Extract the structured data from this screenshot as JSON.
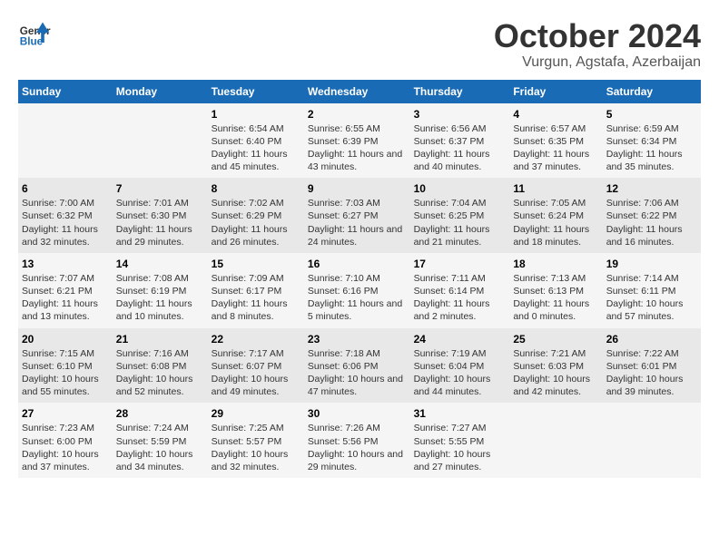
{
  "header": {
    "logo_general": "General",
    "logo_blue": "Blue",
    "month_title": "October 2024",
    "location": "Vurgun, Agstafa, Azerbaijan"
  },
  "days_of_week": [
    "Sunday",
    "Monday",
    "Tuesday",
    "Wednesday",
    "Thursday",
    "Friday",
    "Saturday"
  ],
  "weeks": [
    [
      {
        "day": "",
        "sunrise": "",
        "sunset": "",
        "daylight": ""
      },
      {
        "day": "",
        "sunrise": "",
        "sunset": "",
        "daylight": ""
      },
      {
        "day": "1",
        "sunrise": "Sunrise: 6:54 AM",
        "sunset": "Sunset: 6:40 PM",
        "daylight": "Daylight: 11 hours and 45 minutes."
      },
      {
        "day": "2",
        "sunrise": "Sunrise: 6:55 AM",
        "sunset": "Sunset: 6:39 PM",
        "daylight": "Daylight: 11 hours and 43 minutes."
      },
      {
        "day": "3",
        "sunrise": "Sunrise: 6:56 AM",
        "sunset": "Sunset: 6:37 PM",
        "daylight": "Daylight: 11 hours and 40 minutes."
      },
      {
        "day": "4",
        "sunrise": "Sunrise: 6:57 AM",
        "sunset": "Sunset: 6:35 PM",
        "daylight": "Daylight: 11 hours and 37 minutes."
      },
      {
        "day": "5",
        "sunrise": "Sunrise: 6:59 AM",
        "sunset": "Sunset: 6:34 PM",
        "daylight": "Daylight: 11 hours and 35 minutes."
      }
    ],
    [
      {
        "day": "6",
        "sunrise": "Sunrise: 7:00 AM",
        "sunset": "Sunset: 6:32 PM",
        "daylight": "Daylight: 11 hours and 32 minutes."
      },
      {
        "day": "7",
        "sunrise": "Sunrise: 7:01 AM",
        "sunset": "Sunset: 6:30 PM",
        "daylight": "Daylight: 11 hours and 29 minutes."
      },
      {
        "day": "8",
        "sunrise": "Sunrise: 7:02 AM",
        "sunset": "Sunset: 6:29 PM",
        "daylight": "Daylight: 11 hours and 26 minutes."
      },
      {
        "day": "9",
        "sunrise": "Sunrise: 7:03 AM",
        "sunset": "Sunset: 6:27 PM",
        "daylight": "Daylight: 11 hours and 24 minutes."
      },
      {
        "day": "10",
        "sunrise": "Sunrise: 7:04 AM",
        "sunset": "Sunset: 6:25 PM",
        "daylight": "Daylight: 11 hours and 21 minutes."
      },
      {
        "day": "11",
        "sunrise": "Sunrise: 7:05 AM",
        "sunset": "Sunset: 6:24 PM",
        "daylight": "Daylight: 11 hours and 18 minutes."
      },
      {
        "day": "12",
        "sunrise": "Sunrise: 7:06 AM",
        "sunset": "Sunset: 6:22 PM",
        "daylight": "Daylight: 11 hours and 16 minutes."
      }
    ],
    [
      {
        "day": "13",
        "sunrise": "Sunrise: 7:07 AM",
        "sunset": "Sunset: 6:21 PM",
        "daylight": "Daylight: 11 hours and 13 minutes."
      },
      {
        "day": "14",
        "sunrise": "Sunrise: 7:08 AM",
        "sunset": "Sunset: 6:19 PM",
        "daylight": "Daylight: 11 hours and 10 minutes."
      },
      {
        "day": "15",
        "sunrise": "Sunrise: 7:09 AM",
        "sunset": "Sunset: 6:17 PM",
        "daylight": "Daylight: 11 hours and 8 minutes."
      },
      {
        "day": "16",
        "sunrise": "Sunrise: 7:10 AM",
        "sunset": "Sunset: 6:16 PM",
        "daylight": "Daylight: 11 hours and 5 minutes."
      },
      {
        "day": "17",
        "sunrise": "Sunrise: 7:11 AM",
        "sunset": "Sunset: 6:14 PM",
        "daylight": "Daylight: 11 hours and 2 minutes."
      },
      {
        "day": "18",
        "sunrise": "Sunrise: 7:13 AM",
        "sunset": "Sunset: 6:13 PM",
        "daylight": "Daylight: 11 hours and 0 minutes."
      },
      {
        "day": "19",
        "sunrise": "Sunrise: 7:14 AM",
        "sunset": "Sunset: 6:11 PM",
        "daylight": "Daylight: 10 hours and 57 minutes."
      }
    ],
    [
      {
        "day": "20",
        "sunrise": "Sunrise: 7:15 AM",
        "sunset": "Sunset: 6:10 PM",
        "daylight": "Daylight: 10 hours and 55 minutes."
      },
      {
        "day": "21",
        "sunrise": "Sunrise: 7:16 AM",
        "sunset": "Sunset: 6:08 PM",
        "daylight": "Daylight: 10 hours and 52 minutes."
      },
      {
        "day": "22",
        "sunrise": "Sunrise: 7:17 AM",
        "sunset": "Sunset: 6:07 PM",
        "daylight": "Daylight: 10 hours and 49 minutes."
      },
      {
        "day": "23",
        "sunrise": "Sunrise: 7:18 AM",
        "sunset": "Sunset: 6:06 PM",
        "daylight": "Daylight: 10 hours and 47 minutes."
      },
      {
        "day": "24",
        "sunrise": "Sunrise: 7:19 AM",
        "sunset": "Sunset: 6:04 PM",
        "daylight": "Daylight: 10 hours and 44 minutes."
      },
      {
        "day": "25",
        "sunrise": "Sunrise: 7:21 AM",
        "sunset": "Sunset: 6:03 PM",
        "daylight": "Daylight: 10 hours and 42 minutes."
      },
      {
        "day": "26",
        "sunrise": "Sunrise: 7:22 AM",
        "sunset": "Sunset: 6:01 PM",
        "daylight": "Daylight: 10 hours and 39 minutes."
      }
    ],
    [
      {
        "day": "27",
        "sunrise": "Sunrise: 7:23 AM",
        "sunset": "Sunset: 6:00 PM",
        "daylight": "Daylight: 10 hours and 37 minutes."
      },
      {
        "day": "28",
        "sunrise": "Sunrise: 7:24 AM",
        "sunset": "Sunset: 5:59 PM",
        "daylight": "Daylight: 10 hours and 34 minutes."
      },
      {
        "day": "29",
        "sunrise": "Sunrise: 7:25 AM",
        "sunset": "Sunset: 5:57 PM",
        "daylight": "Daylight: 10 hours and 32 minutes."
      },
      {
        "day": "30",
        "sunrise": "Sunrise: 7:26 AM",
        "sunset": "Sunset: 5:56 PM",
        "daylight": "Daylight: 10 hours and 29 minutes."
      },
      {
        "day": "31",
        "sunrise": "Sunrise: 7:27 AM",
        "sunset": "Sunset: 5:55 PM",
        "daylight": "Daylight: 10 hours and 27 minutes."
      },
      {
        "day": "",
        "sunrise": "",
        "sunset": "",
        "daylight": ""
      },
      {
        "day": "",
        "sunrise": "",
        "sunset": "",
        "daylight": ""
      }
    ]
  ]
}
